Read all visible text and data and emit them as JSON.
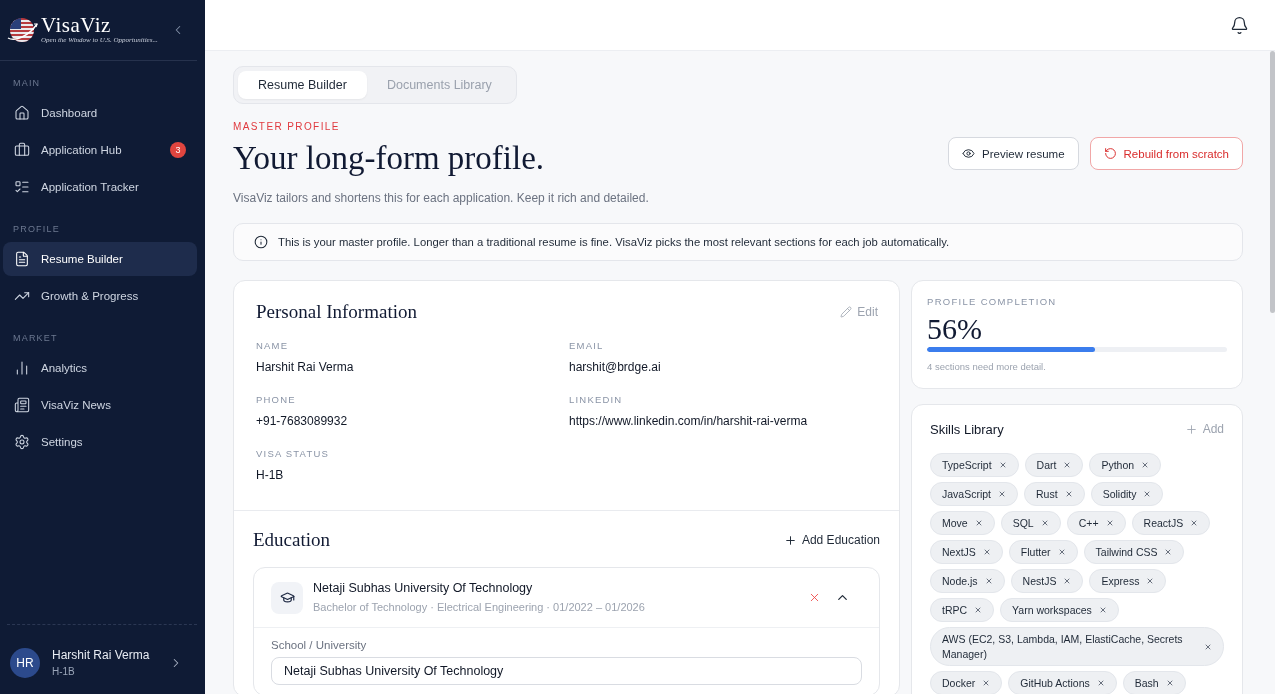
{
  "sidebar": {
    "logo": {
      "name": "VisaViz",
      "tagline": "Open the Window to U.S. Opportunities..."
    },
    "sections": [
      {
        "title": "MAIN",
        "items": [
          {
            "label": "Dashboard",
            "selected": false
          },
          {
            "label": "Application Hub",
            "selected": false,
            "badge": "3"
          },
          {
            "label": "Application Tracker",
            "selected": false
          }
        ]
      },
      {
        "title": "PROFILE",
        "items": [
          {
            "label": "Resume Builder",
            "selected": true
          },
          {
            "label": "Growth & Progress",
            "selected": false
          }
        ]
      },
      {
        "title": "MARKET",
        "items": [
          {
            "label": "Analytics",
            "selected": false
          },
          {
            "label": "VisaViz News",
            "selected": false
          },
          {
            "label": "Settings",
            "selected": false
          }
        ]
      }
    ],
    "user": {
      "initials": "HR",
      "name": "Harshit Rai Verma",
      "status": "H-1B"
    }
  },
  "tabs": [
    {
      "label": "Resume Builder",
      "selected": true
    },
    {
      "label": "Documents Library",
      "selected": false
    }
  ],
  "header": {
    "eyebrow": "MASTER PROFILE",
    "title": "Your long-form profile.",
    "subtitle": "VisaViz tailors and shortens this for each application. Keep it rich and detailed.",
    "buttons": [
      {
        "label": "Preview resume",
        "kind": "secondary"
      },
      {
        "label": "Rebuild from scratch",
        "kind": "danger"
      }
    ]
  },
  "notice": "This is your master profile. Longer than a traditional resume is fine. VisaViz picks the most relevant sections for each job automatically.",
  "personal_information": {
    "title": "Personal Information",
    "edit_label": "Edit",
    "fields": [
      {
        "label": "NAME",
        "value": "Harshit Rai Verma"
      },
      {
        "label": "EMAIL",
        "value": "harshit@brdge.ai"
      },
      {
        "label": "PHONE",
        "value": "+91-7683089932"
      },
      {
        "label": "LINKEDIN",
        "value": "https://www.linkedin.com/in/harshit-rai-verma"
      },
      {
        "label": "VISA STATUS",
        "value": "H-1B"
      }
    ]
  },
  "education": {
    "title": "Education",
    "add_label": "Add Education",
    "entries": [
      {
        "school": "Netaji Subhas University Of Technology",
        "details": "Bachelor of Technology · Electrical Engineering · 01/2022 – 01/2026",
        "expanded": true,
        "form": [
          {
            "label": "School / University",
            "value": "Netaji Subhas University Of Technology"
          }
        ]
      }
    ]
  },
  "profile_completion": {
    "label": "PROFILE COMPLETION",
    "value": "56%",
    "level": 0.56,
    "note": "4 sections need more detail."
  },
  "skills": {
    "title": "Skills Library",
    "add_label": "Add",
    "items": [
      "TypeScript",
      "Dart",
      "Python",
      "JavaScript",
      "Rust",
      "Solidity",
      "Move",
      "SQL",
      "C++",
      "ReactJS",
      "NextJS",
      "Flutter",
      "Tailwind CSS",
      "Node.js",
      "NestJS",
      "Express",
      "tRPC",
      "Yarn workspaces",
      "AWS (EC2, S3, Lambda, IAM, ElastiCache, Secrets Manager)",
      "Docker",
      "GitHub Actions",
      "Bash"
    ]
  }
}
